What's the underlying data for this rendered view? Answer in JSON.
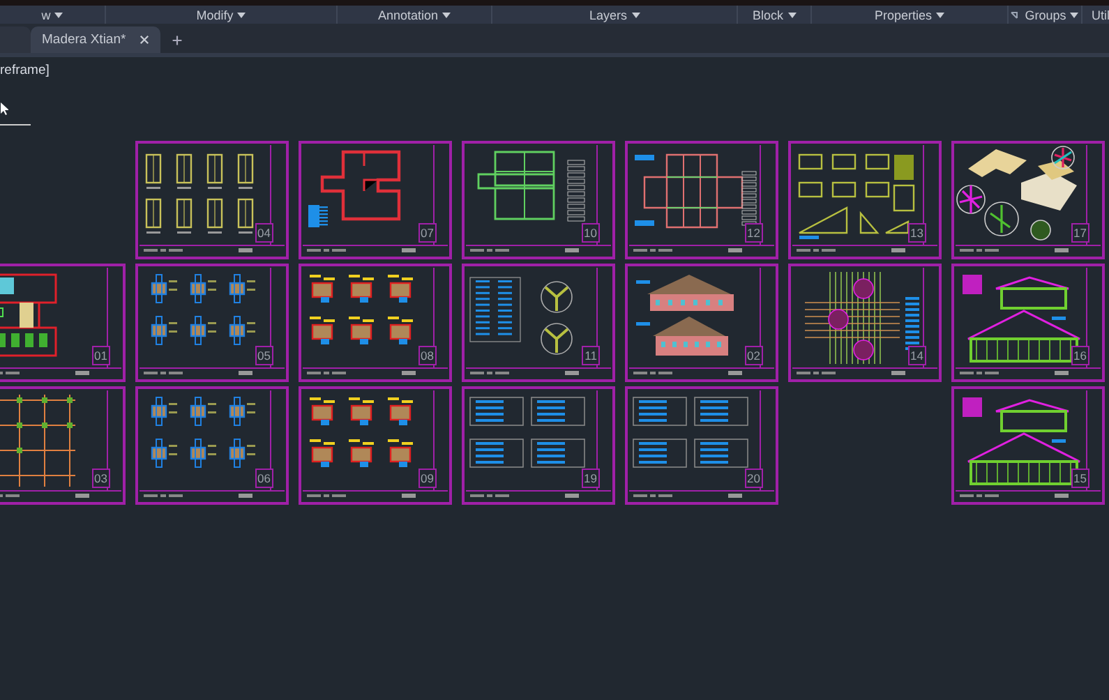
{
  "ribbon": {
    "panels": [
      {
        "label": "w"
      },
      {
        "label": "Modify"
      },
      {
        "label": "Annotation"
      },
      {
        "label": "Layers"
      },
      {
        "label": "Block"
      },
      {
        "label": "Properties"
      },
      {
        "label": "Groups"
      },
      {
        "label": "Util"
      }
    ]
  },
  "file_tab": {
    "label": "Madera Xtian*",
    "selected": true
  },
  "viewport_label": "reframe]",
  "sheets": [
    {
      "number": "04",
      "kind": "windows"
    },
    {
      "number": "07",
      "kind": "wall-plan"
    },
    {
      "number": "10",
      "kind": "beam-plan"
    },
    {
      "number": "12",
      "kind": "grid-plan"
    },
    {
      "number": "13",
      "kind": "trusses"
    },
    {
      "number": "17",
      "kind": "isometric"
    },
    {
      "number": "01",
      "kind": "furnished-plan"
    },
    {
      "number": "05",
      "kind": "details-blue"
    },
    {
      "number": "08",
      "kind": "details-yellow"
    },
    {
      "number": "11",
      "kind": "joints"
    },
    {
      "number": "02",
      "kind": "elevation"
    },
    {
      "number": "14",
      "kind": "framing"
    },
    {
      "number": "16",
      "kind": "frame-elevation"
    },
    {
      "number": "03",
      "kind": "foundation-plan"
    },
    {
      "number": "06",
      "kind": "details-blue"
    },
    {
      "number": "09",
      "kind": "details-yellow"
    },
    {
      "number": "19",
      "kind": "tables"
    },
    {
      "number": "20",
      "kind": "tables"
    },
    {
      "number": "15",
      "kind": "frame-elevation"
    }
  ]
}
